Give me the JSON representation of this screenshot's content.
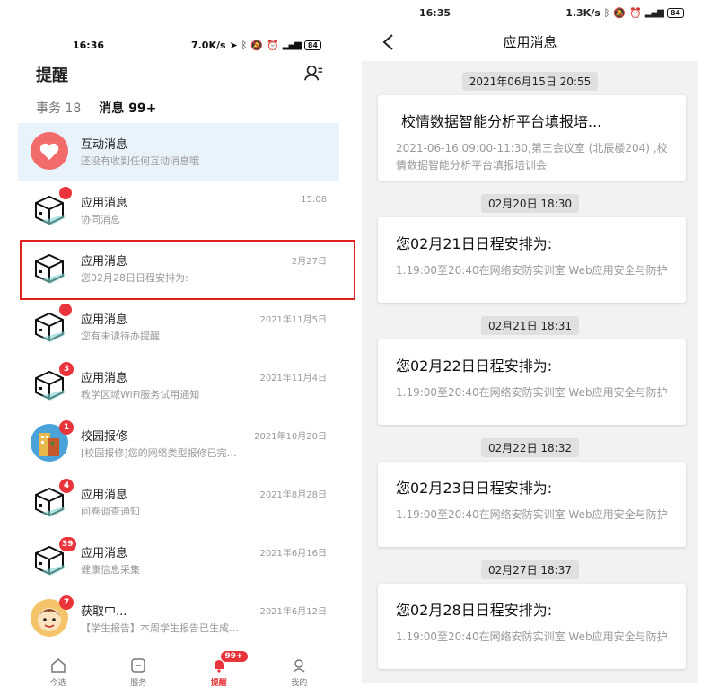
{
  "left": {
    "status": {
      "time": "16:36",
      "speed": "7.0K/s",
      "battery": "84",
      "net": "5G"
    },
    "header": {
      "title": "提醒"
    },
    "tabs": [
      {
        "label": "事务",
        "count": "18"
      },
      {
        "label": "消息",
        "count": "99+"
      }
    ],
    "items": [
      {
        "title": "互动消息",
        "sub": "还没有收到任何互动消息哦",
        "time": "",
        "badge": ""
      },
      {
        "title": "应用消息",
        "sub": "协同消息",
        "time": "15:08",
        "badge": ""
      },
      {
        "title": "应用消息",
        "sub": "您02月28日日程安排为:",
        "time": "2月27日",
        "badge": ""
      },
      {
        "title": "应用消息",
        "sub": "您有未读待办提醒",
        "time": "2021年11月5日",
        "badge": ""
      },
      {
        "title": "应用消息",
        "sub": "教学区域WiFi服务试用通知",
        "time": "2021年11月4日",
        "badge": "3"
      },
      {
        "title": "校园报修",
        "sub": "[校园报修]您的网络类型报修已完…",
        "time": "2021年10月20日",
        "badge": "1"
      },
      {
        "title": "应用消息",
        "sub": "问卷调查通知",
        "time": "2021年8月28日",
        "badge": "4"
      },
      {
        "title": "应用消息",
        "sub": "健康信息采集",
        "time": "2021年6月16日",
        "badge": "39"
      },
      {
        "title": "获取中...",
        "sub": "【学生报告】本周学生报告已生成…",
        "time": "2021年6月12日",
        "badge": "7"
      }
    ],
    "tabbar": [
      {
        "label": "今选"
      },
      {
        "label": "服务"
      },
      {
        "label": "提醒",
        "badge": "99+"
      },
      {
        "label": "我的"
      }
    ]
  },
  "right": {
    "status": {
      "time": "16:35",
      "speed": "1.3K/s",
      "battery": "84",
      "net": "5G"
    },
    "nav": {
      "title": "应用消息"
    },
    "messages": [
      {
        "stamp": "2021年06月15日 20:55",
        "title": "校情数据智能分析平台填报培...",
        "body": "2021-06-16 09:00-11:30,第三会议室 (北辰楼204) ,校情数据智能分析平台填报培训会"
      },
      {
        "stamp": "02月20日 18:30",
        "title": "您02月21日日程安排为:",
        "body": "1.19:00至20:40在网络安防实训室 Web应用安全与防护"
      },
      {
        "stamp": "02月21日 18:31",
        "title": "您02月22日日程安排为:",
        "body": "1.19:00至20:40在网络安防实训室 Web应用安全与防护"
      },
      {
        "stamp": "02月22日 18:32",
        "title": "您02月23日日程安排为:",
        "body": "1.19:00至20:40在网络安防实训室 Web应用安全与防护"
      },
      {
        "stamp": "02月27日 18:37",
        "title": "您02月28日日程安排为:",
        "body": "1.19:00至20:40在网络安防实训室 Web应用安全与防护"
      }
    ]
  },
  "colors": {
    "accent": "#e8343a",
    "highlight_bg": "#e9f3fc",
    "panel_bg": "#f2f2f2"
  }
}
